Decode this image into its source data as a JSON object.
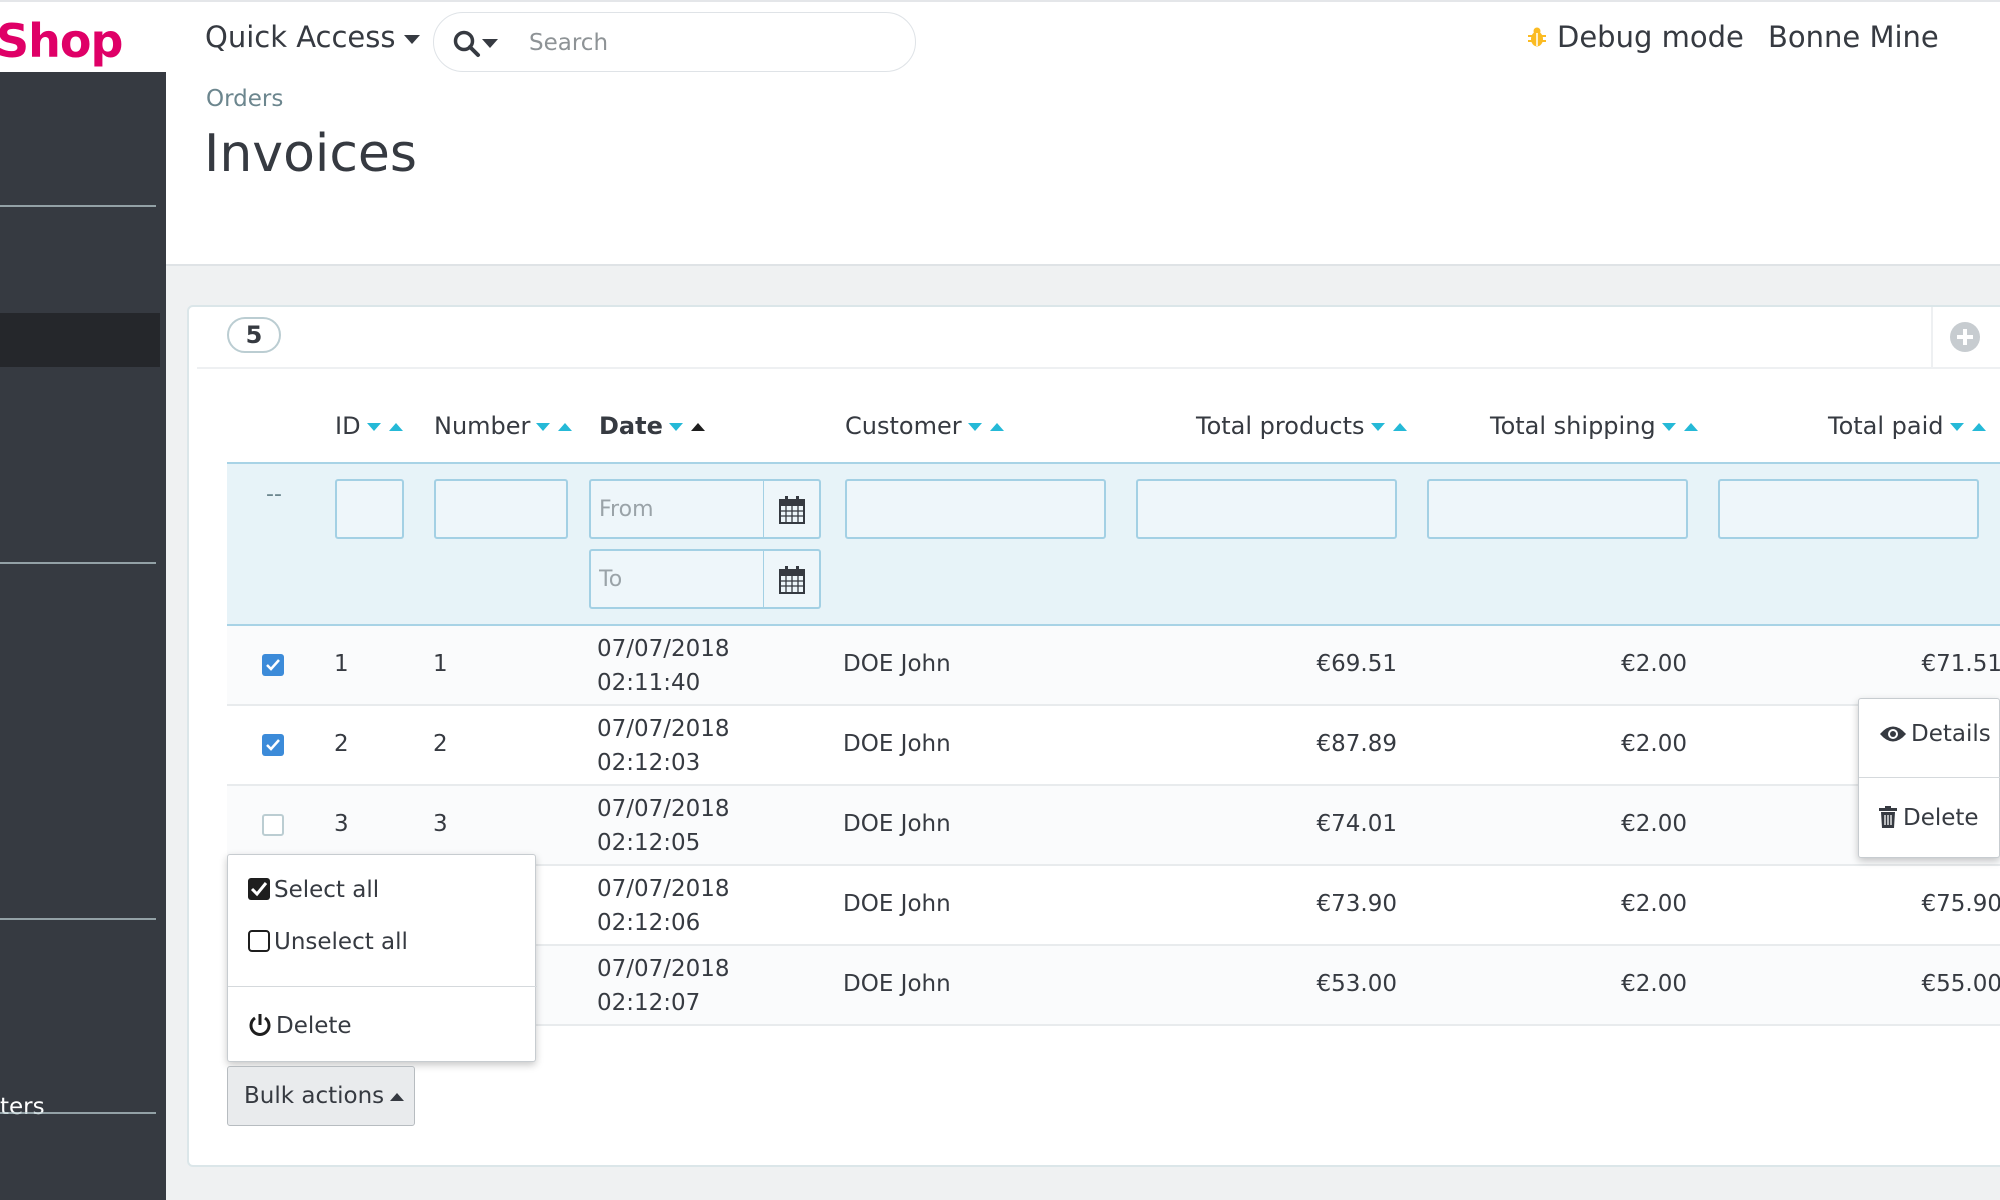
{
  "header": {
    "logo_text": "Shop",
    "quick_access": "Quick Access",
    "search_placeholder": "Search",
    "debug_mode": "Debug mode",
    "shop_name": "Bonne Mine"
  },
  "sidebar": {
    "partial_label": "ters"
  },
  "page": {
    "breadcrumb": "Orders",
    "title": "Invoices"
  },
  "panel": {
    "count": "5"
  },
  "table": {
    "columns": {
      "id": "ID",
      "number": "Number",
      "date": "Date",
      "customer": "Customer",
      "total_products": "Total products",
      "total_shipping": "Total shipping",
      "total_paid": "Total paid"
    },
    "filters": {
      "dash": "--",
      "from_placeholder": "From",
      "to_placeholder": "To"
    },
    "rows": [
      {
        "checked": true,
        "id": "1",
        "number": "1",
        "date": "07/07/2018",
        "time": "02:11:40",
        "customer": "DOE John",
        "total_products": "€69.51",
        "total_shipping": "€2.00",
        "total_paid": "€71.51"
      },
      {
        "checked": true,
        "id": "2",
        "number": "2",
        "date": "07/07/2018",
        "time": "02:12:03",
        "customer": "DOE John",
        "total_products": "€87.89",
        "total_shipping": "€2.00",
        "total_paid": ""
      },
      {
        "checked": false,
        "id": "3",
        "number": "3",
        "date": "07/07/2018",
        "time": "02:12:05",
        "customer": "DOE John",
        "total_products": "€74.01",
        "total_shipping": "€2.00",
        "total_paid": ""
      },
      {
        "checked": false,
        "id": "",
        "number": "",
        "date": "07/07/2018",
        "time": "02:12:06",
        "customer": "DOE John",
        "total_products": "€73.90",
        "total_shipping": "€2.00",
        "total_paid": "€75.90"
      },
      {
        "checked": false,
        "id": "",
        "number": "",
        "date": "07/07/2018",
        "time": "02:12:07",
        "customer": "DOE John",
        "total_products": "€53.00",
        "total_shipping": "€2.00",
        "total_paid": "€55.00"
      }
    ]
  },
  "row_actions_menu": {
    "details": "Details",
    "delete": "Delete"
  },
  "bulk_menu": {
    "select_all": "Select all",
    "unselect_all": "Unselect all",
    "delete": "Delete"
  },
  "bulk_button": "Bulk actions",
  "colors": {
    "brand": "#df0067",
    "sidebar": "#363a41",
    "accent": "#25b9d7",
    "checkbox": "#3c8bd9",
    "filter_bg": "#e7f3f8"
  }
}
